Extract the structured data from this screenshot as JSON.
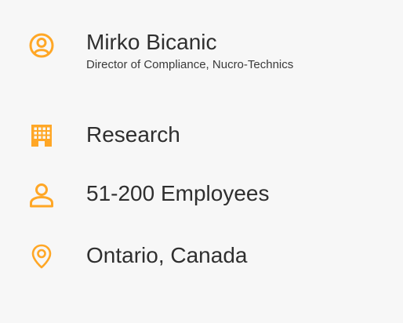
{
  "accent_color": "#ffa726",
  "person": {
    "icon": "account-circle-icon",
    "name": "Mirko Bicanic",
    "role": "Director of Compliance, Nucro-Technics"
  },
  "industry": {
    "icon": "building-icon",
    "label": "Research"
  },
  "company_size": {
    "icon": "person-icon",
    "label": "51-200 Employees"
  },
  "location": {
    "icon": "location-pin-icon",
    "label": "Ontario, Canada"
  }
}
